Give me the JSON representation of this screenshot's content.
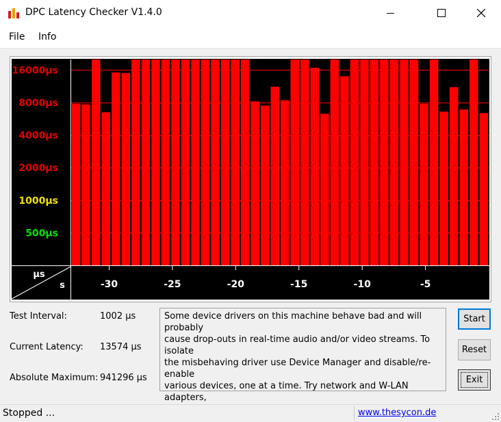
{
  "window": {
    "title": "DPC Latency Checker V1.4.0"
  },
  "menu": {
    "items": [
      "File",
      "Info"
    ]
  },
  "chart_data": {
    "type": "bar",
    "y_scale": "log2",
    "ylim_us": [
      250,
      20000
    ],
    "y_ticks": [
      {
        "label": "16000µs",
        "value": 16000,
        "color": "#e00000"
      },
      {
        "label": "8000µs",
        "value": 8000,
        "color": "#e00000"
      },
      {
        "label": "4000µs",
        "value": 4000,
        "color": "#e00000"
      },
      {
        "label": "2000µs",
        "value": 2000,
        "color": "#e00000"
      },
      {
        "label": "1000µs",
        "value": 1000,
        "color": "#f0e000"
      },
      {
        "label": "500µs",
        "value": 500,
        "color": "#00e000"
      }
    ],
    "x_ticks": [
      {
        "label": "-30",
        "value": -30
      },
      {
        "label": "-25",
        "value": -25
      },
      {
        "label": "-20",
        "value": -20
      },
      {
        "label": "-15",
        "value": -15
      },
      {
        "label": "-10",
        "value": -10
      },
      {
        "label": "-5",
        "value": -5
      }
    ],
    "corner_labels": {
      "y_unit": "µs",
      "x_unit": "s"
    },
    "xlim_s": [
      -33,
      0
    ],
    "bar_color": "#ff0000",
    "grid_color": "#ff0000",
    "background": "#000000",
    "values_us": [
      7800,
      7700,
      20000,
      6500,
      15200,
      15000,
      20000,
      20000,
      20000,
      20000,
      20000,
      20000,
      20000,
      20000,
      20000,
      20000,
      20000,
      20000,
      8200,
      7500,
      11200,
      8400,
      20000,
      20000,
      16800,
      6300,
      20000,
      14000,
      20000,
      20000,
      20000,
      20000,
      20000,
      20000,
      20000,
      7800,
      20000,
      6600,
      11100,
      6900,
      20000,
      6400
    ]
  },
  "stats": {
    "test_interval_label": "Test Interval:",
    "test_interval_value": "1002 µs",
    "current_latency_label": "Current Latency:",
    "current_latency_value": "13574 µs",
    "absolute_max_label": "Absolute Maximum:",
    "absolute_max_value": "941296 µs"
  },
  "message": "Some device drivers on this machine behave bad and will probably\ncause drop-outs in real-time audio and/or video streams. To isolate\nthe misbehaving driver use Device Manager and disable/re-enable\nvarious devices, one at a time. Try network and W-LAN adapters,\nmodems, internal sound devices, USB host controllers, etc.",
  "buttons": {
    "start": "Start",
    "reset": "Reset",
    "exit": "Exit"
  },
  "status": {
    "text": "Stopped ...",
    "link": "www.thesycon.de"
  },
  "colors": {
    "accent": "#0078d7",
    "link": "#0000ee"
  }
}
